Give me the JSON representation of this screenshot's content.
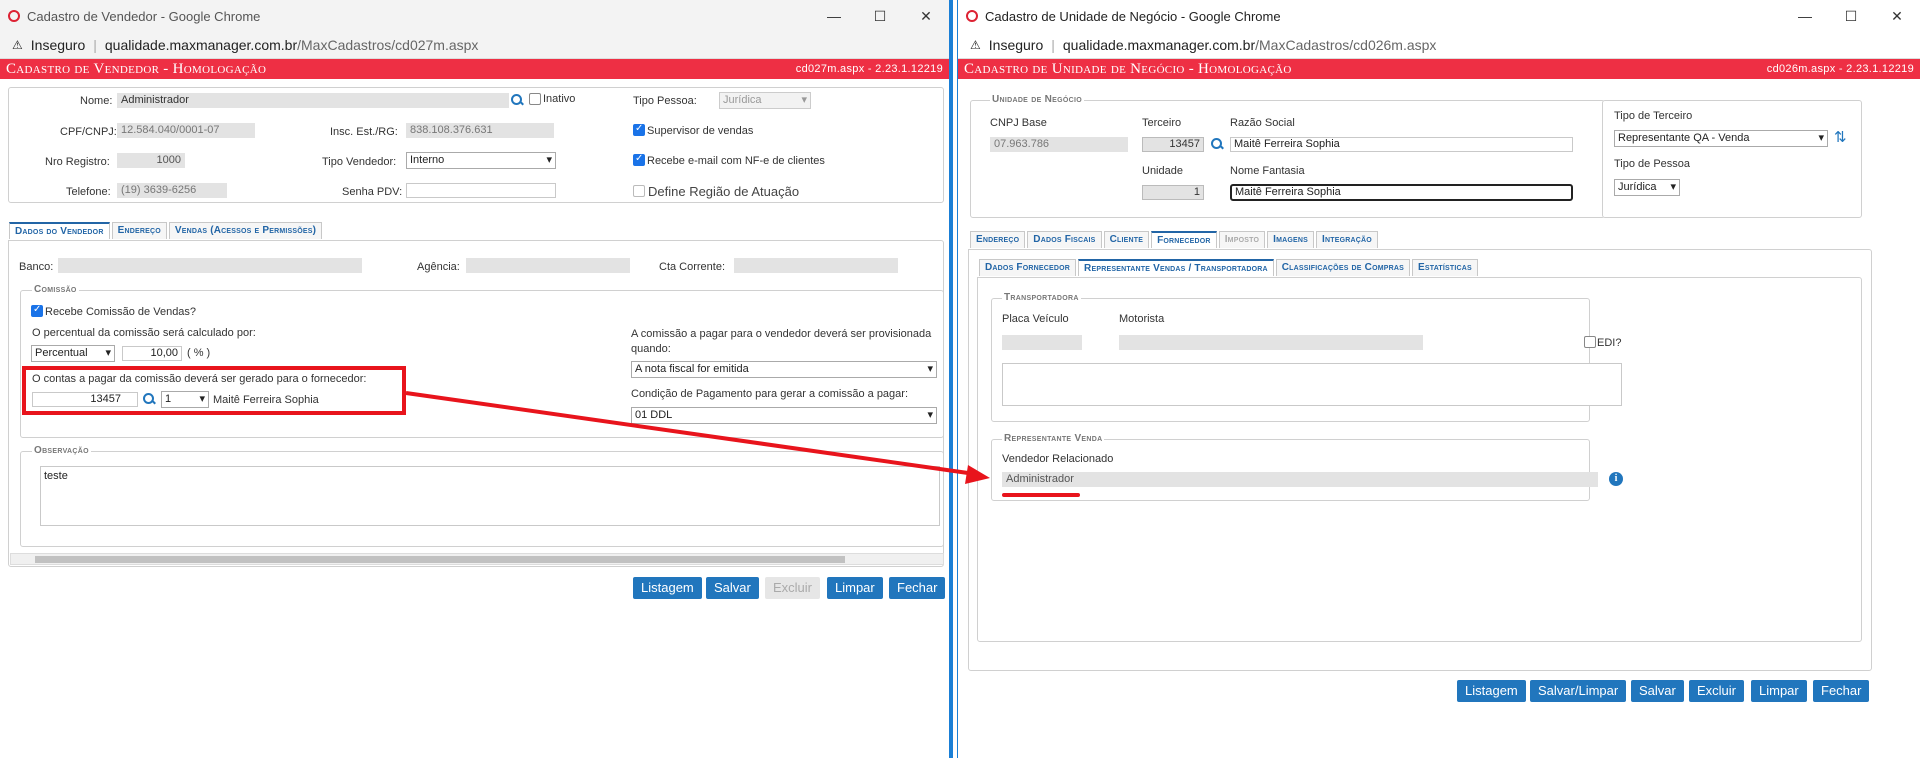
{
  "left": {
    "title": "Cadastro de Vendedor - Google Chrome",
    "insecure": "Inseguro",
    "host": "qualidade.maxmanager.com.br",
    "path": "/MaxCadastros/cd027m.aspx",
    "header": "Cadastro de Vendedor  - Homologação",
    "version": "cd027m.aspx - 2.23.1.12219",
    "nome_label": "Nome:",
    "nome": "Administrador",
    "inativo": "Inativo",
    "tipo_pessoa_label": "Tipo Pessoa:",
    "tipo_pessoa": "Jurídica",
    "cpf_label": "CPF/CNPJ:",
    "cpf": "12.584.040/0001-07",
    "insc_label": "Insc. Est./RG:",
    "insc": "838.108.376.631",
    "supervisor": "Supervisor de vendas",
    "nro_label": "Nro Registro:",
    "nro": "1000",
    "tipo_vend_label": "Tipo Vendedor:",
    "tipo_vend": "Interno",
    "recebe_email": "Recebe e-mail com NF-e de clientes",
    "tel_label": "Telefone:",
    "tel": "(19) 3639-6256",
    "senha_label": "Senha PDV:",
    "define": "Define Região de Atuação",
    "tabs": [
      "Dados do Vendedor",
      "Endereço",
      "Vendas (Acessos e Permissões)"
    ],
    "banco": "Banco:",
    "agencia": "Agência:",
    "cta": "Cta Corrente:",
    "comissao_legend": "Comissão",
    "recebe_comissao": "Recebe Comissão de Vendas?",
    "percentual_q": "O percentual da comissão será calculado por:",
    "percentual_sel": "Percentual",
    "percentual_val": "10,00",
    "percentual_unit": "( % )",
    "provisionada_q": "A comissão a pagar para o vendedor deverá ser provisionada quando:",
    "provisionada_sel": "A nota fiscal for emitida",
    "contas_q": "O contas a pagar da comissão deverá ser gerado para o fornecedor:",
    "forn_cod": "13457",
    "forn_unid": "1",
    "forn_nome": "Maitê Ferreira Sophia",
    "cond_q": "Condição de Pagamento para gerar a comissão a pagar:",
    "cond_sel": "01 DDL",
    "obs_legend": "Observação",
    "obs": "teste",
    "buttons": [
      "Listagem",
      "Salvar",
      "Excluir",
      "Limpar",
      "Fechar"
    ]
  },
  "right": {
    "title": "Cadastro de Unidade de Negócio - Google Chrome",
    "insecure": "Inseguro",
    "host": "qualidade.maxmanager.com.br",
    "path": "/MaxCadastros/cd026m.aspx",
    "header": "Cadastro de Unidade de Negócio  - Homologação",
    "version": "cd026m.aspx - 2.23.1.12219",
    "un_legend": "Unidade de Negócio",
    "cnpj_label": "CNPJ Base",
    "cnpj": "07.963.786",
    "terceiro_label": "Terceiro",
    "terceiro": "13457",
    "razao_label": "Razão Social",
    "razao": "Maitê Ferreira Sophia",
    "unidade_label": "Unidade",
    "unidade": "1",
    "fantasia_label": "Nome Fantasia",
    "fantasia": "Maitê Ferreira Sophia",
    "tipo_terc_label": "Tipo de Terceiro",
    "tipo_terc": "Representante QA - Venda",
    "tipo_pes_label": "Tipo de Pessoa",
    "tipo_pes": "Jurídica",
    "tabs": [
      "Endereço",
      "Dados Fiscais",
      "Cliente",
      "Fornecedor",
      "Imposto",
      "Imagens",
      "Integração"
    ],
    "subtabs": [
      "Dados Fornecedor",
      "Representante Vendas / Transportadora",
      "Classificações de Compras",
      "Estatísticas"
    ],
    "transp_legend": "Transportadora",
    "placa": "Placa Veículo",
    "motorista": "Motorista",
    "edi": "EDI?",
    "rep_legend": "Representante Venda",
    "vend_rel": "Vendedor Relacionado",
    "vend_rel_val": "Administrador",
    "buttons": [
      "Listagem",
      "Salvar/Limpar",
      "Salvar",
      "Excluir",
      "Limpar",
      "Fechar"
    ]
  },
  "colors": {
    "header": "#ee2f44",
    "accent": "#2176bd",
    "highlight": "#e8141c"
  }
}
